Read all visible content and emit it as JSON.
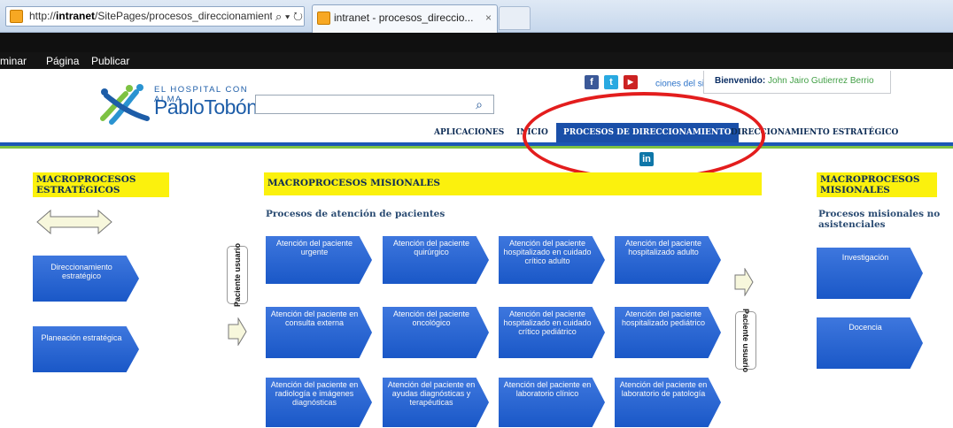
{
  "browser": {
    "url_prefix": "http://",
    "url_host": "intranet",
    "url_path": "/SitePages/procesos_direccionamiento.",
    "address_icons": "⌕ ▾ ↻",
    "tab_title": "intranet - procesos_direccio...",
    "tab_close": "×"
  },
  "ribbon": {
    "items": [
      "minar",
      "Página",
      "Publicar"
    ]
  },
  "header": {
    "logo_small": "EL HOSPITAL CON ALMA",
    "logo_big": "PabloTobónUribe",
    "search_placeholder": "",
    "search_icon": "⌕",
    "social_icons": [
      "f",
      "t",
      "▶",
      "in"
    ],
    "social_text": "ciones del sitio",
    "welcome_label": "Bienvenido:",
    "welcome_user": "John Jairo Gutierrez Berrio"
  },
  "nav": {
    "items": [
      "APLICACIONES",
      "INICIO",
      "PROCESOS DE DIRECCIONAMIENTO",
      "DIRECCIONAMIENTO ESTRATÉGICO"
    ],
    "active": "PROCESOS DE DIRECCIONAMIENTO"
  },
  "left": {
    "header": "MACROPROCESOS ESTRATÉGICOS",
    "buttons": [
      "Direccionamiento estratégico",
      "Planeación estratégica"
    ]
  },
  "center": {
    "header": "MACROPROCESOS MISIONALES",
    "subtitle": "Procesos de atención de pacientes",
    "row1": [
      "Atención del paciente urgente",
      "Atención del paciente quirúrgico",
      "Atención del paciente hospitalizado en cuidado crítico adulto",
      "Atención del paciente hospitalizado adulto"
    ],
    "row2": [
      "Atención del paciente en consulta externa",
      "Atención del paciente oncológico",
      "Atención del paciente hospitalizado en cuidado crítico pediátrico",
      "Atención del paciente hospitalizado pediátrico"
    ],
    "row3": [
      "Atención del paciente en radiología e imágenes diagnósticas",
      "Atención del paciente en ayudas diagnósticas y terapéuticas",
      "Atención del paciente en laboratorio clínico",
      "Atención del paciente en laboratorio de patología"
    ],
    "left_label": "Paciente usuario",
    "right_label": "Paciente usuario"
  },
  "right": {
    "header": "MACROPROCESOS MISIONALES",
    "subtitle": "Procesos misionales no asistenciales",
    "buttons": [
      "Investigación",
      "Docencia"
    ]
  },
  "colors": {
    "accent_blue": "#1c5fd8",
    "nav_active": "#1a4fa8",
    "header_yellow": "#fbf10d",
    "highlight_red": "#e31d1d",
    "line_green": "#7dc242"
  }
}
